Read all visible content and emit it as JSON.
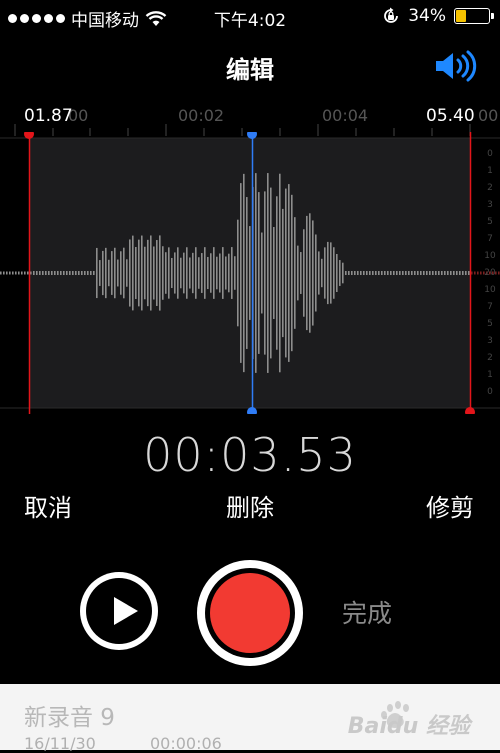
{
  "status_bar": {
    "carrier": "中国移动",
    "time": "下午4:02",
    "battery_percent": "34%",
    "battery_level": 0.34,
    "battery_color": "#f5c200"
  },
  "header": {
    "title": "编辑",
    "speaker_icon_color": "#1e88ff"
  },
  "timeline": {
    "ticks": [
      "00",
      "00:02",
      "00:04",
      "00"
    ],
    "start_marker": "01.87",
    "end_marker": "05.40"
  },
  "waveform": {
    "playhead_color": "#2f7cf6",
    "trim_color": "#e3151a",
    "db_scale": [
      "0",
      "1",
      "2",
      "3",
      "5",
      "7",
      "10",
      "20",
      "10",
      "7",
      "5",
      "3",
      "2",
      "1",
      "0"
    ]
  },
  "readout": "00:03.53",
  "actions": {
    "cancel": "取消",
    "delete": "删除",
    "trim": "修剪"
  },
  "controls": {
    "done": "完成",
    "record_color": "#f23a32"
  },
  "recording": {
    "name": "新录音 9",
    "date": "16/11/30",
    "duration": "00:00:06"
  },
  "watermark": {
    "text": "Baidu 经验"
  }
}
